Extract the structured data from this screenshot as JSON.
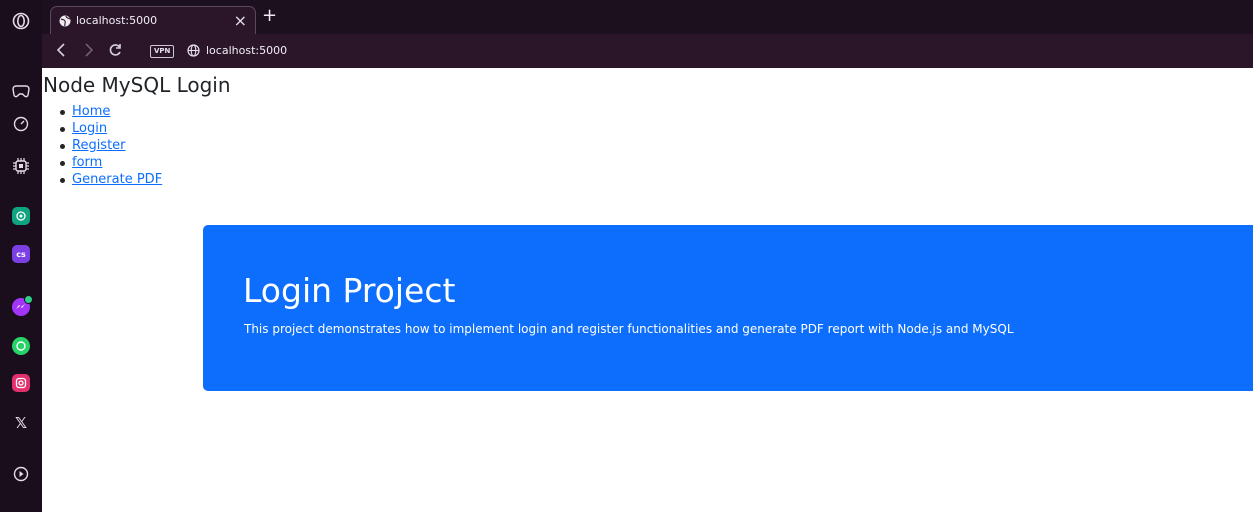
{
  "browser": {
    "tab": {
      "title": "localhost:5000"
    },
    "new_tab_symbol": "+",
    "close_symbol": "×",
    "address": {
      "url": "localhost:5000",
      "vpn_label": "VPN"
    }
  },
  "sidebar": {
    "items": [
      {
        "name": "opera-logo-icon"
      },
      {
        "name": "gaming-controller-icon"
      },
      {
        "name": "speed-dial-icon"
      },
      {
        "name": "ai-chip-icon"
      },
      {
        "name": "chatgpt-icon",
        "color": "#10a37f"
      },
      {
        "name": "chatsonic-icon",
        "color": "#7b3fe4"
      },
      {
        "name": "messenger-icon",
        "color": "#a334fa"
      },
      {
        "name": "whatsapp-icon",
        "color": "#25d366"
      },
      {
        "name": "instagram-icon",
        "color": "#e1306c"
      },
      {
        "name": "x-twitter-icon"
      },
      {
        "name": "player-icon"
      }
    ],
    "x_label": "𝕏"
  },
  "page": {
    "site_title": "Node MySQL Login",
    "nav_links": [
      "Home",
      "Login",
      "Register",
      "form",
      "Generate PDF"
    ],
    "jumbotron": {
      "title": "Login Project",
      "text": "This project demonstrates how to implement login and register functionalities and generate PDF report with Node.js and MySQL"
    }
  },
  "colors": {
    "link": "#0d6efd",
    "jumbotron_bg": "#0d6efd",
    "browser_chrome": "#2a1529"
  }
}
